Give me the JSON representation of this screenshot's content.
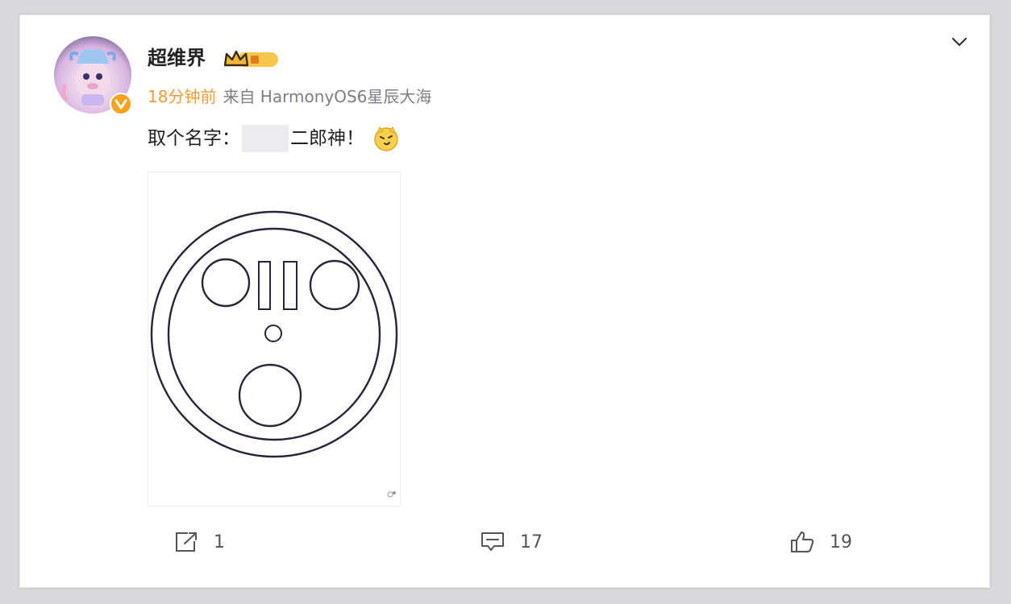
{
  "post": {
    "author": "超维界",
    "time": "18分钟前",
    "source": "来自 HarmonyOS6星辰大海",
    "text_before": "取个名字：",
    "text_after": "二郎神！",
    "emoji_icon": "smirking-face-emoji",
    "badge_icon": "crown-level-badge"
  },
  "actions": {
    "repost_count": "1",
    "comment_count": "17",
    "like_count": "19"
  },
  "colors": {
    "time_orange": "#f29d38",
    "verified_orange": "#f7a11e",
    "text_dark": "#222222",
    "meta_gray": "#7e7e84"
  }
}
